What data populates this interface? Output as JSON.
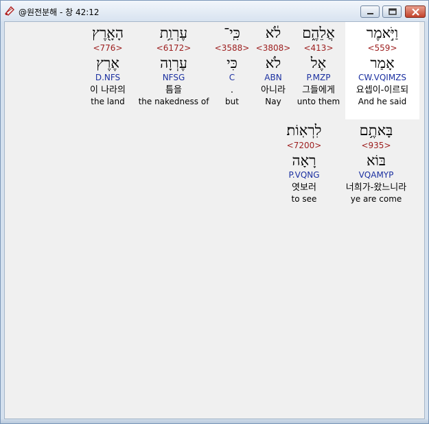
{
  "window": {
    "title": "@원전분해 - 창 42:12",
    "icon": "app-icon"
  },
  "colors": {
    "strongs": "#9c1c1c",
    "morph": "#1a2fa0",
    "highlight": "#ffffff"
  },
  "rows": [
    {
      "words": [
        {
          "heb": "וַיֹּ֣אמֶר",
          "num": "<559>",
          "root": "אָמַר",
          "morph": "CW.VQIMZS",
          "kor": "요셉이-이르되",
          "eng": "And he said",
          "highlight": true
        },
        {
          "heb": "אֲלֵהֶ֑ם",
          "num": "<413>",
          "root": "אֶל",
          "morph": "P.MZP",
          "kor": "그들에게",
          "eng": "unto them"
        },
        {
          "heb": "לֹ֔א",
          "num": "<3808>",
          "root": "לֹא",
          "morph": "ABN",
          "kor": "아니라",
          "eng": "Nay"
        },
        {
          "heb": "כִּֽי־",
          "num": "<3588>",
          "root": "כִּי",
          "morph": "C",
          "kor": ".",
          "eng": "but"
        },
        {
          "heb": "עֶרְוַ֥ת",
          "num": "<6172>",
          "root": "עֶרְוָה",
          "morph": "NFSG",
          "kor": "틈을",
          "eng": "the nakedness of"
        },
        {
          "heb": "הָאָ֖רֶץ",
          "num": "<776>",
          "root": "אֶרֶץ",
          "morph": "D.NFS",
          "kor": "이 나라의",
          "eng": "the land"
        }
      ]
    },
    {
      "words": [
        {
          "heb": "בָּאתֶ֥ם",
          "num": "<935>",
          "root": "בּוֹא",
          "morph": "VQAMYP",
          "kor": "너희가-왔느니라",
          "eng": "ye are come"
        },
        {
          "heb": "לִרְאֽוֹת׃",
          "num": "<7200>",
          "root": "רָאָה",
          "morph": "P.VQNG",
          "kor": "엿보러",
          "eng": "to see"
        }
      ]
    }
  ]
}
